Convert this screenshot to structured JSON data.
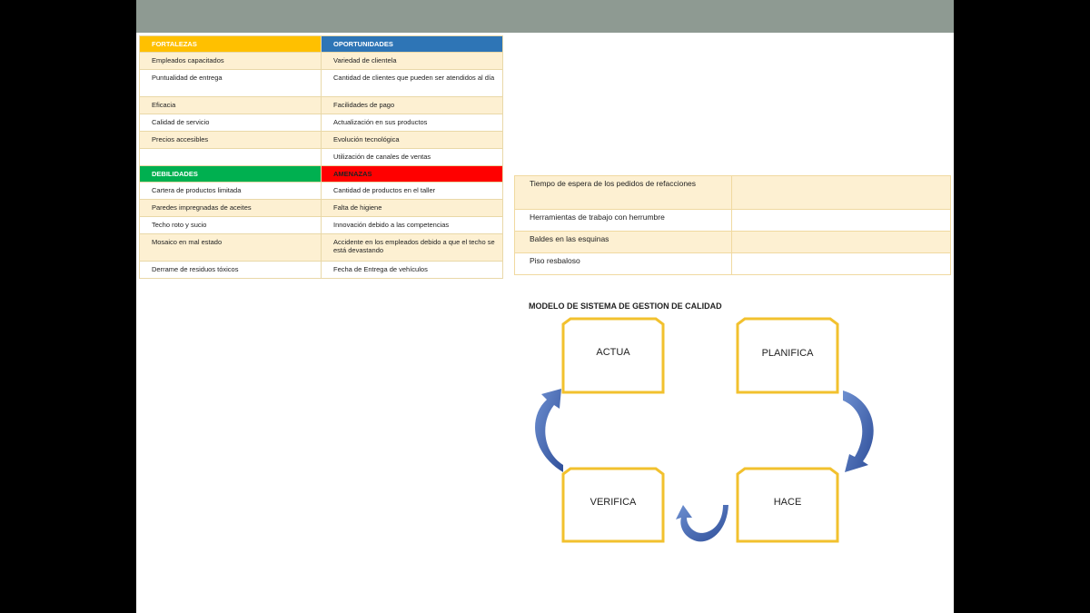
{
  "swot": {
    "fortalezas_label": "FORTALEZAS",
    "oportunidades_label": "OPORTUNIDADES",
    "debilidades_label": "DEBILIDADES",
    "amenazas_label": "AMENAZAS",
    "top_rows": [
      [
        "Empleados capacitados",
        "Variedad de clientela"
      ],
      [
        "Puntualidad de entrega",
        "Cantidad de clientes que pueden ser atendidos al día"
      ],
      [
        "Eficacia",
        "Facilidades de pago"
      ],
      [
        "Calidad de servicio",
        "Actualización en sus productos"
      ],
      [
        "Precios accesibles",
        "Evolución tecnológica"
      ],
      [
        "",
        "Utilización de canales de ventas"
      ]
    ],
    "bottom_rows": [
      [
        "Cartera de productos limitada",
        "Cantidad de productos en el taller"
      ],
      [
        "Paredes impregnadas de aceites",
        "Falta de higiene"
      ],
      [
        "Techo roto y sucio",
        "Innovación debido a las competencias"
      ],
      [
        "Mosaico en mal estado",
        "Accidente en los empleados debido a que el techo se está devastando"
      ],
      [
        "Derrame de residuos tóxicos",
        "Fecha de Entrega de vehículos"
      ]
    ]
  },
  "issues": [
    "Tiempo de espera de los pedidos de refacciones",
    "Herramientas de trabajo con herrumbre",
    "Baldes en las esquinas",
    "Piso resbaloso"
  ],
  "pdca": {
    "title": "MODELO DE SISTEMA DE GESTION DE CALIDAD",
    "actua": "ACTUA",
    "planifica": "PLANIFICA",
    "hace": "HACE",
    "verifica": "VERIFICA"
  },
  "colors": {
    "fortalezas": "#ffc000",
    "oportunidades": "#2e75b6",
    "debilidades": "#00b050",
    "amenazas": "#ff0000",
    "box_border": "#f2c12e",
    "arrow": "#4a6fb5"
  }
}
